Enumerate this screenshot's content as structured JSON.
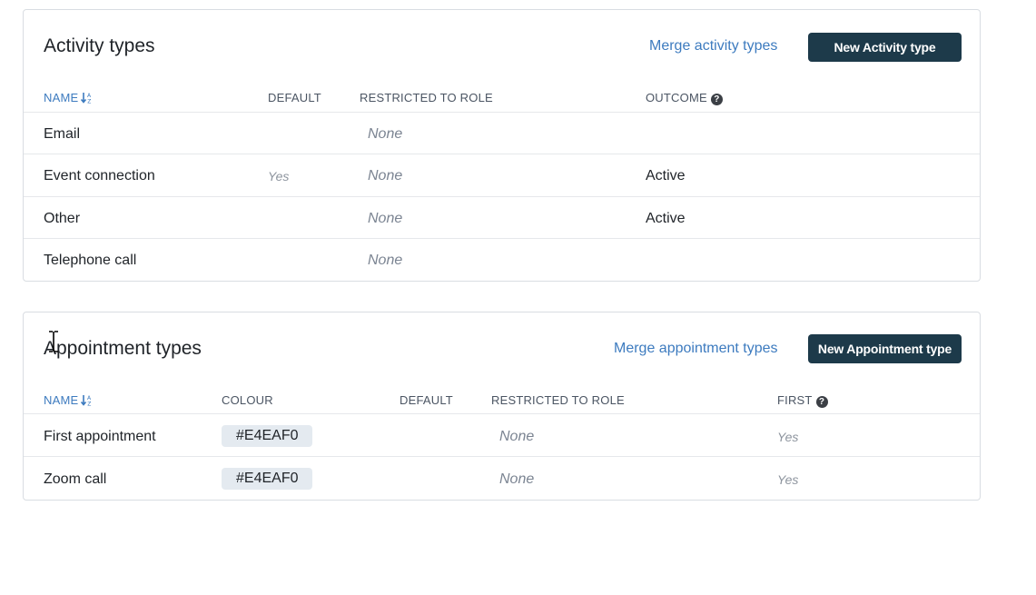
{
  "activity_types": {
    "title": "Activity types",
    "merge_label": "Merge activity types",
    "new_button_label": "New Activity type",
    "columns": {
      "name": "NAME",
      "default": "DEFAULT",
      "restricted": "RESTRICTED TO ROLE",
      "outcome": "OUTCOME"
    },
    "rows": [
      {
        "name": "Email",
        "default": "",
        "restricted": "None",
        "outcome": ""
      },
      {
        "name": "Event connection",
        "default": "Yes",
        "restricted": "None",
        "outcome": "Active"
      },
      {
        "name": "Other",
        "default": "",
        "restricted": "None",
        "outcome": "Active"
      },
      {
        "name": "Telephone call",
        "default": "",
        "restricted": "None",
        "outcome": ""
      }
    ]
  },
  "appointment_types": {
    "title": "Appointment types",
    "merge_label": "Merge appointment types",
    "new_button_label": "New Appointment type",
    "columns": {
      "name": "NAME",
      "colour": "COLOUR",
      "default": "DEFAULT",
      "restricted": "RESTRICTED TO ROLE",
      "first": "FIRST"
    },
    "rows": [
      {
        "name": "First appointment",
        "colour": "#E4EAF0",
        "default": "",
        "restricted": "None",
        "first": "Yes"
      },
      {
        "name": "Zoom call",
        "colour": "#E4EAF0",
        "default": "",
        "restricted": "None",
        "first": "Yes"
      }
    ]
  },
  "icons": {
    "sort": "sort-alpha-icon",
    "help": "question-circle-icon",
    "cursor": "text-cursor-icon"
  },
  "colors": {
    "primary_button": "#1d3a4a",
    "link": "#3d7bbf",
    "chip": "#e4eaf0"
  }
}
